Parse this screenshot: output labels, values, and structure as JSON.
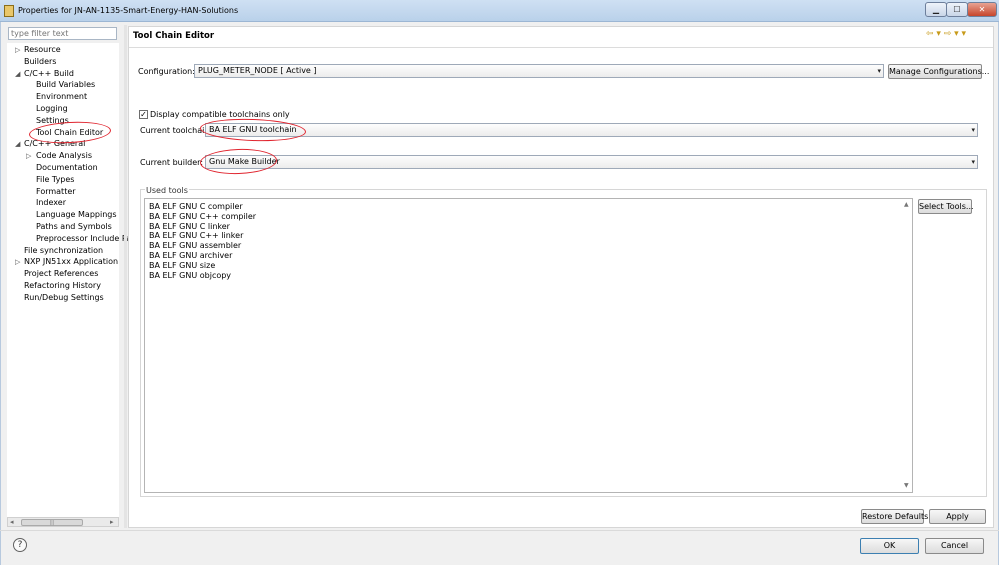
{
  "window": {
    "title": "Properties for JN-AN-1135-Smart-Energy-HAN-Solutions",
    "controls": {
      "minimize": "▁",
      "maximize": "☐",
      "close": "✕"
    }
  },
  "left": {
    "filter_placeholder": "type filter text",
    "tree": [
      {
        "label": "Resource",
        "twisty": "▷"
      },
      {
        "label": "Builders",
        "twisty": ""
      },
      {
        "label": "C/C++ Build",
        "twisty": "◢"
      },
      {
        "label": "Build Variables",
        "twisty": ""
      },
      {
        "label": "Environment",
        "twisty": ""
      },
      {
        "label": "Logging",
        "twisty": ""
      },
      {
        "label": "Settings",
        "twisty": ""
      },
      {
        "label": "Tool Chain Editor",
        "twisty": ""
      },
      {
        "label": "C/C++ General",
        "twisty": "◢"
      },
      {
        "label": "Code Analysis",
        "twisty": "▷"
      },
      {
        "label": "Documentation",
        "twisty": ""
      },
      {
        "label": "File Types",
        "twisty": ""
      },
      {
        "label": "Formatter",
        "twisty": ""
      },
      {
        "label": "Indexer",
        "twisty": ""
      },
      {
        "label": "Language Mappings",
        "twisty": ""
      },
      {
        "label": "Paths and Symbols",
        "twisty": ""
      },
      {
        "label": "Preprocessor Include Pa",
        "twisty": ""
      },
      {
        "label": "File synchronization",
        "twisty": ""
      },
      {
        "label": "NXP JN51xx Application",
        "twisty": "▷"
      },
      {
        "label": "Project References",
        "twisty": ""
      },
      {
        "label": "Refactoring History",
        "twisty": ""
      },
      {
        "label": "Run/Debug Settings",
        "twisty": ""
      }
    ],
    "scroll_left": "◂",
    "scroll_right": "▸",
    "scroll_thumb": "|||"
  },
  "page": {
    "title": "Tool Chain Editor",
    "nav_icons": "⇦ ▾ ⇨ ▾ ▾",
    "configuration_label": "Configuration:",
    "configuration_value": "PLUG_METER_NODE  [ Active ]",
    "manage_button": "Manage Configurations...",
    "display_compatible_label": "Display compatible toolchains only",
    "display_compatible_checked": "✓",
    "current_toolchain_label": "Current toolchain:",
    "current_toolchain_value": "BA ELF GNU toolchain",
    "current_builder_label": "Current builder:",
    "current_builder_value": "Gnu Make Builder",
    "used_tools_label": "Used tools",
    "used_tools": [
      "BA ELF GNU C compiler",
      "BA ELF GNU C++ compiler",
      "BA ELF GNU C linker",
      "BA ELF GNU C++ linker",
      "BA ELF GNU assembler",
      "BA ELF GNU archiver",
      "BA ELF GNU size",
      "BA ELF GNU objcopy"
    ],
    "select_tools_button": "Select Tools...",
    "restore_defaults_button": "Restore Defaults",
    "apply_button": "Apply",
    "dropdown_arrow": "▾",
    "scroll_up": "▲",
    "scroll_down": "▼"
  },
  "footer": {
    "help_icon": "?",
    "ok_button": "OK",
    "cancel_button": "Cancel"
  },
  "colors": {
    "annotation": "#e0242e",
    "titlebar": "#cfe0f3"
  }
}
